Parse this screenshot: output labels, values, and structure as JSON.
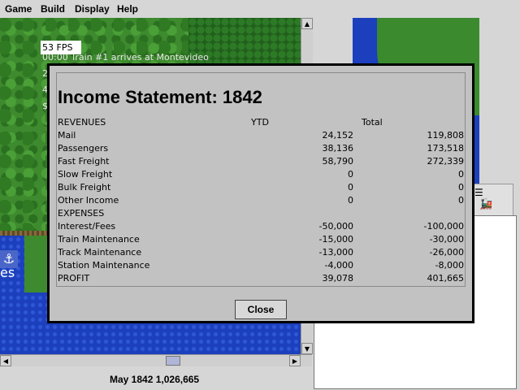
{
  "menu": [
    "Game",
    "Build",
    "Display",
    "Help"
  ],
  "overlay": {
    "fps": "53 FPS",
    "messages": [
      "00:00 Train #1 arrives at Montevideo",
      "2",
      "4",
      "$"
    ]
  },
  "map": {
    "label": "es"
  },
  "status": {
    "date": "May 1842",
    "cash": "1,026,665"
  },
  "dialog": {
    "title": "Income Statement: 1842",
    "header": {
      "section": "REVENUES",
      "ytd": "YTD",
      "total": "Total"
    },
    "revenues": [
      {
        "label": "Mail",
        "ytd": "24,152",
        "total": "119,808"
      },
      {
        "label": "Passengers",
        "ytd": "38,136",
        "total": "173,518"
      },
      {
        "label": "Fast Freight",
        "ytd": "58,790",
        "total": "272,339"
      },
      {
        "label": "Slow Freight",
        "ytd": "0",
        "total": "0"
      },
      {
        "label": "Bulk Freight",
        "ytd": "0",
        "total": "0"
      },
      {
        "label": "Other Income",
        "ytd": "0",
        "total": "0"
      }
    ],
    "expenses_header": "EXPENSES",
    "expenses": [
      {
        "label": "Interest/Fees",
        "ytd": "-50,000",
        "total": "-100,000"
      },
      {
        "label": "Train Maintenance",
        "ytd": "-15,000",
        "total": "-30,000"
      },
      {
        "label": "Track Maintenance",
        "ytd": "-13,000",
        "total": "-26,000"
      },
      {
        "label": "Station Maintenance",
        "ytd": "-4,000",
        "total": "-8,000"
      }
    ],
    "profit": {
      "label": "PROFIT",
      "ytd": "39,078",
      "total": "401,665"
    },
    "close_label": "Close"
  },
  "icons": [
    "anchor-icon",
    "list-icon",
    "locomotive-icon",
    "scroll-up-icon",
    "scroll-down-icon",
    "scroll-left-icon",
    "scroll-right-icon"
  ]
}
